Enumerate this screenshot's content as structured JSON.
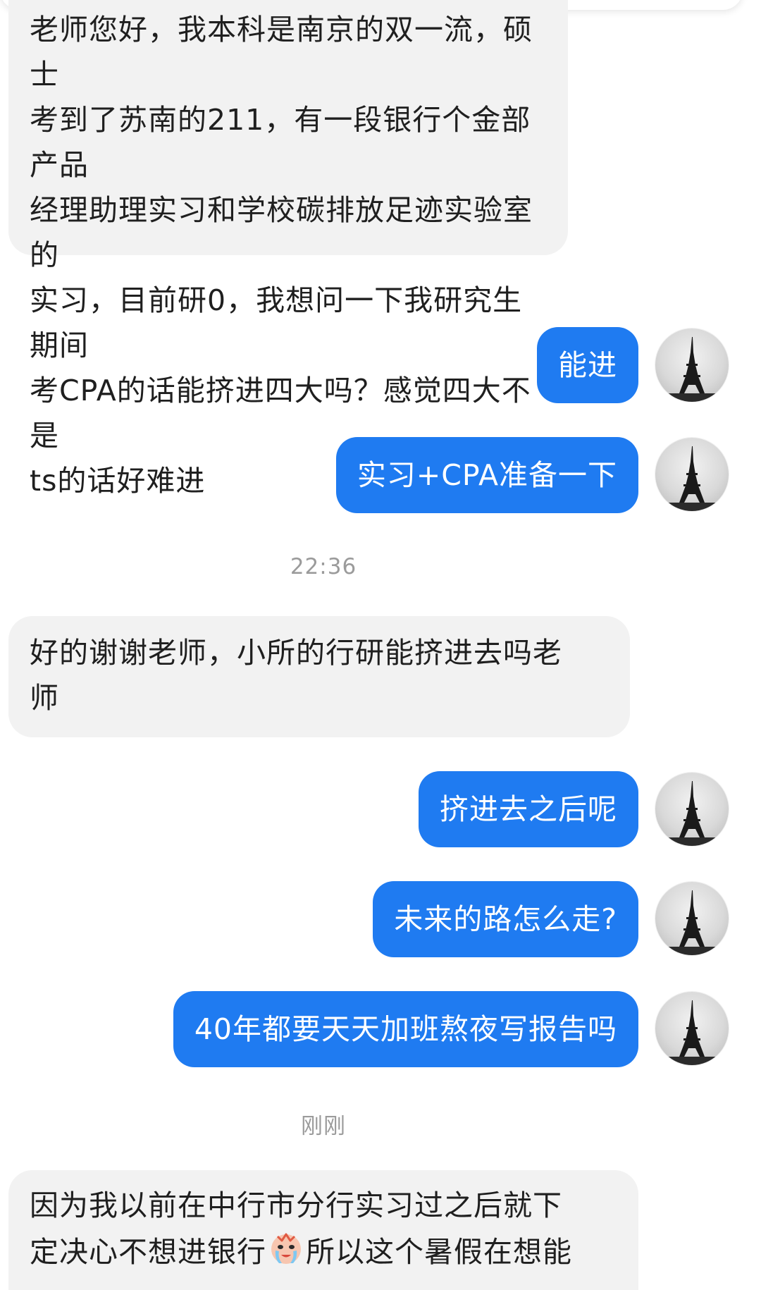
{
  "messages": [
    {
      "id": "m1",
      "side": "in",
      "lines": [
        "老师您好，我本科是南京的双一流，硕士",
        "考到了苏南的211，有一段银行个金部产品",
        "经理助理实习和学校碳排放足迹实验室的",
        "实习，目前研0，我想问一下我研究生期间",
        "考CPA的话能挤进四大吗？感觉四大不是",
        "ts的话好难进"
      ]
    },
    {
      "id": "m2",
      "side": "out",
      "text": "能进"
    },
    {
      "id": "m3",
      "side": "out",
      "text": "实习+CPA准备一下"
    },
    {
      "id": "m4",
      "side": "in",
      "lines": [
        "好的谢谢老师，小所的行研能挤进去吗老",
        "师"
      ]
    },
    {
      "id": "m5",
      "side": "out",
      "text": "挤进去之后呢"
    },
    {
      "id": "m6",
      "side": "out",
      "text": "未来的路怎么走?"
    },
    {
      "id": "m7",
      "side": "out",
      "text": "40年都要天天加班熬夜写报告吗"
    },
    {
      "id": "m8",
      "side": "in",
      "line1": "因为我以前在中行市分行实习过之后就下",
      "line2_before": "定决心不想进银行",
      "line2_after": "所以这个暑假在想能",
      "emoji": "crying-emoji"
    }
  ],
  "timestamps": [
    "22:36",
    "刚刚"
  ],
  "avatar": {
    "icon": "eiffel-tower-icon"
  },
  "colors": {
    "outgoing_bubble": "#1f7bf1",
    "incoming_bubble": "#f2f2f2",
    "timestamp_text": "#9b9b9b"
  }
}
